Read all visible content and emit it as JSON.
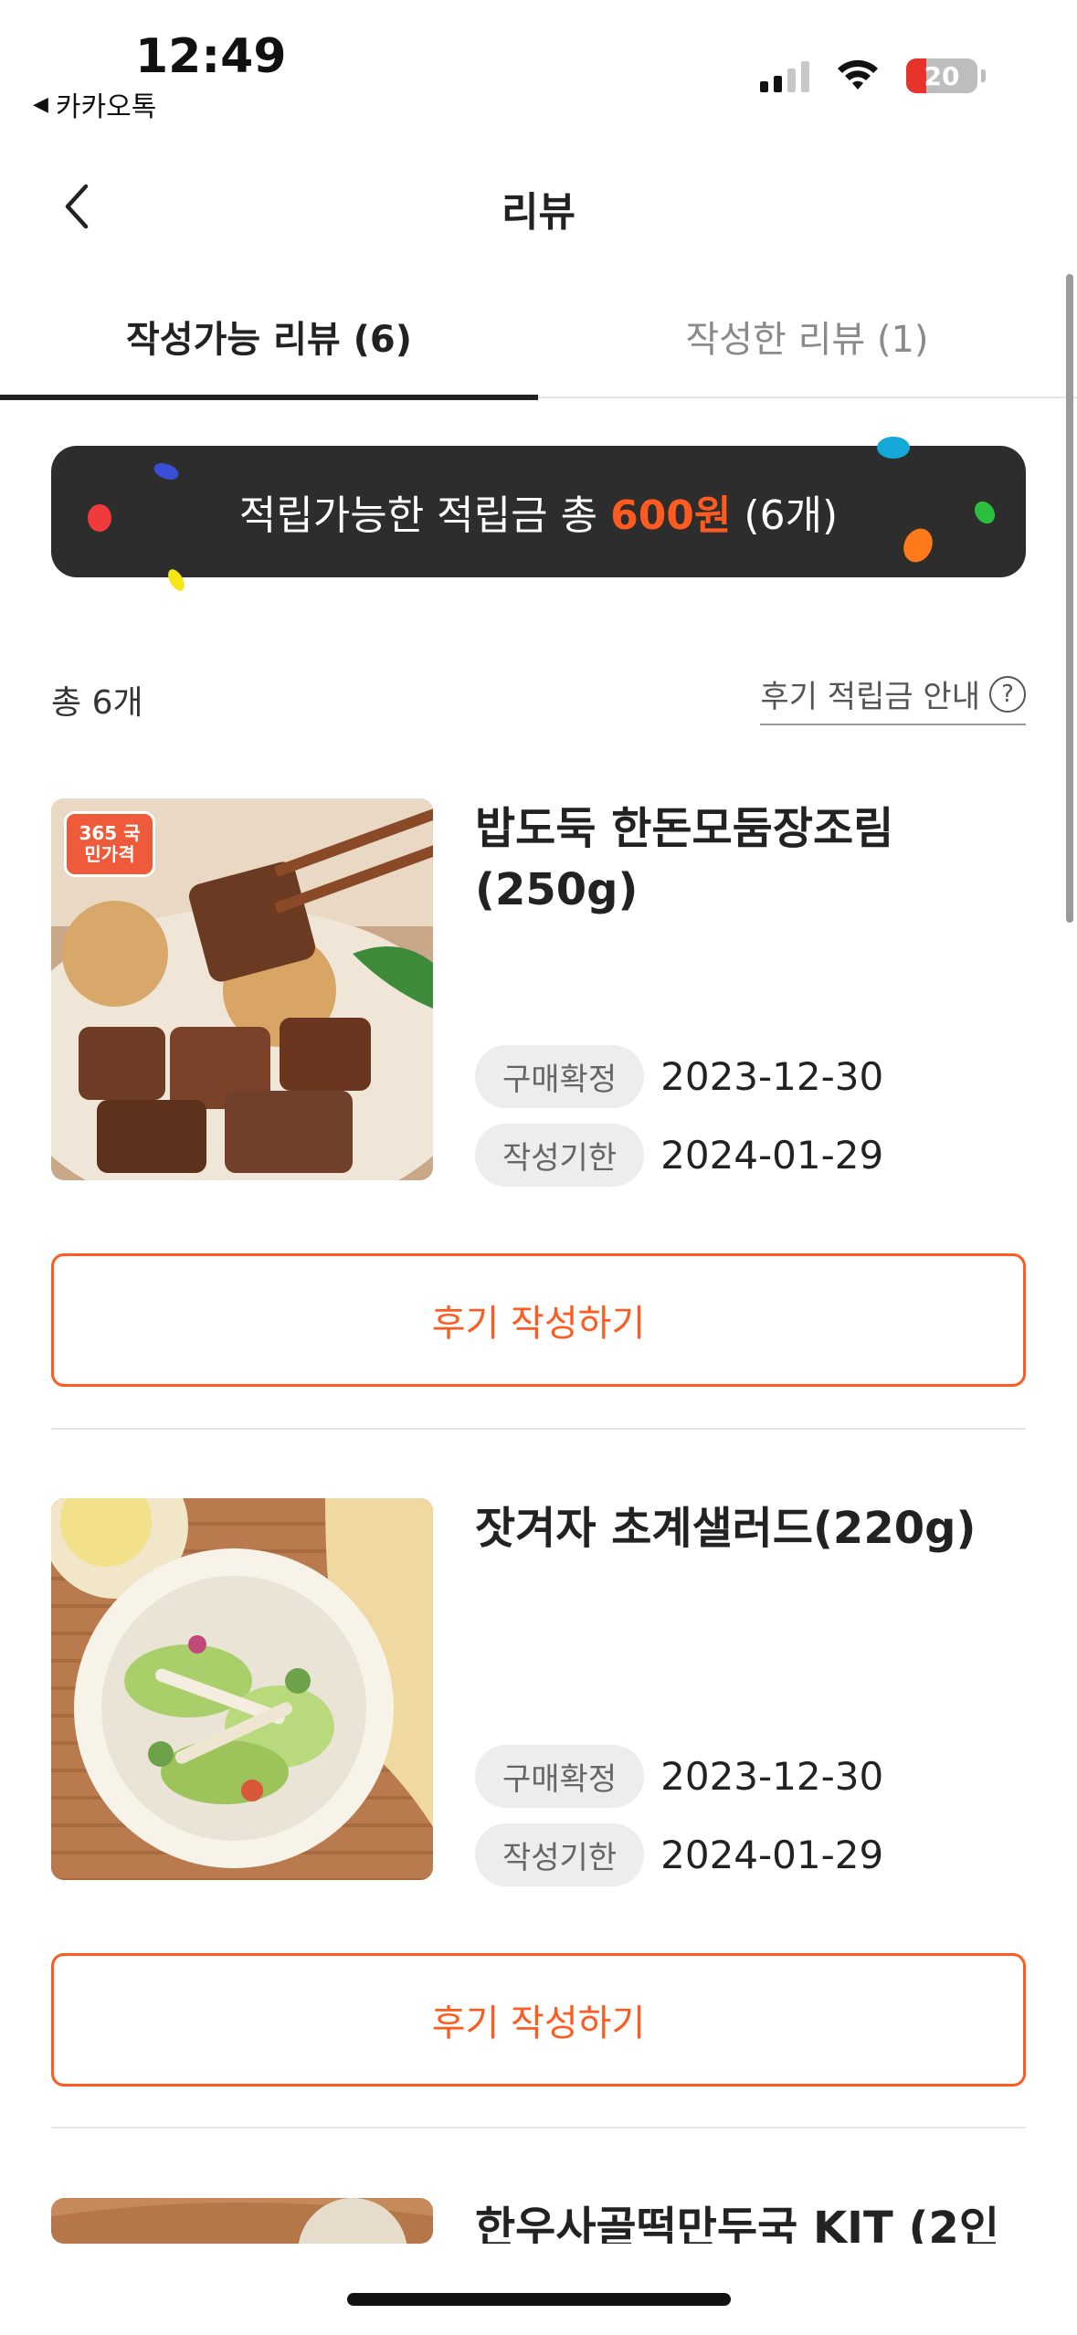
{
  "status_bar": {
    "time": "12:49",
    "back_app": "카카오톡",
    "battery": "20"
  },
  "header": {
    "title": "리뷰"
  },
  "tabs": [
    {
      "label": "작성가능 리뷰 (6)",
      "active": true
    },
    {
      "label": "작성한 리뷰 (1)",
      "active": false
    }
  ],
  "banner": {
    "prefix": "적립가능한 적립금 총",
    "amount": "600원",
    "suffix": "(6개)"
  },
  "summary": {
    "total": "총 6개",
    "guide": "후기 적립금 안내"
  },
  "items": [
    {
      "name": "밥도둑 한돈모둠장조림 (250g)",
      "badge": "365 국민가격",
      "purchase_label": "구매확정",
      "purchase_date": "2023-12-30",
      "deadline_label": "작성기한",
      "deadline_date": "2024-01-29",
      "button": "후기 작성하기"
    },
    {
      "name": "잣겨자 초계샐러드(220g)",
      "purchase_label": "구매확정",
      "purchase_date": "2023-12-30",
      "deadline_label": "작성기한",
      "deadline_date": "2024-01-29",
      "button": "후기 작성하기"
    },
    {
      "name": "한우사골떡만두국 KIT (2인"
    }
  ],
  "colors": {
    "accent": "#ff5a1f",
    "banner_bg": "#2d2d2d",
    "chip_bg": "#ededed"
  }
}
